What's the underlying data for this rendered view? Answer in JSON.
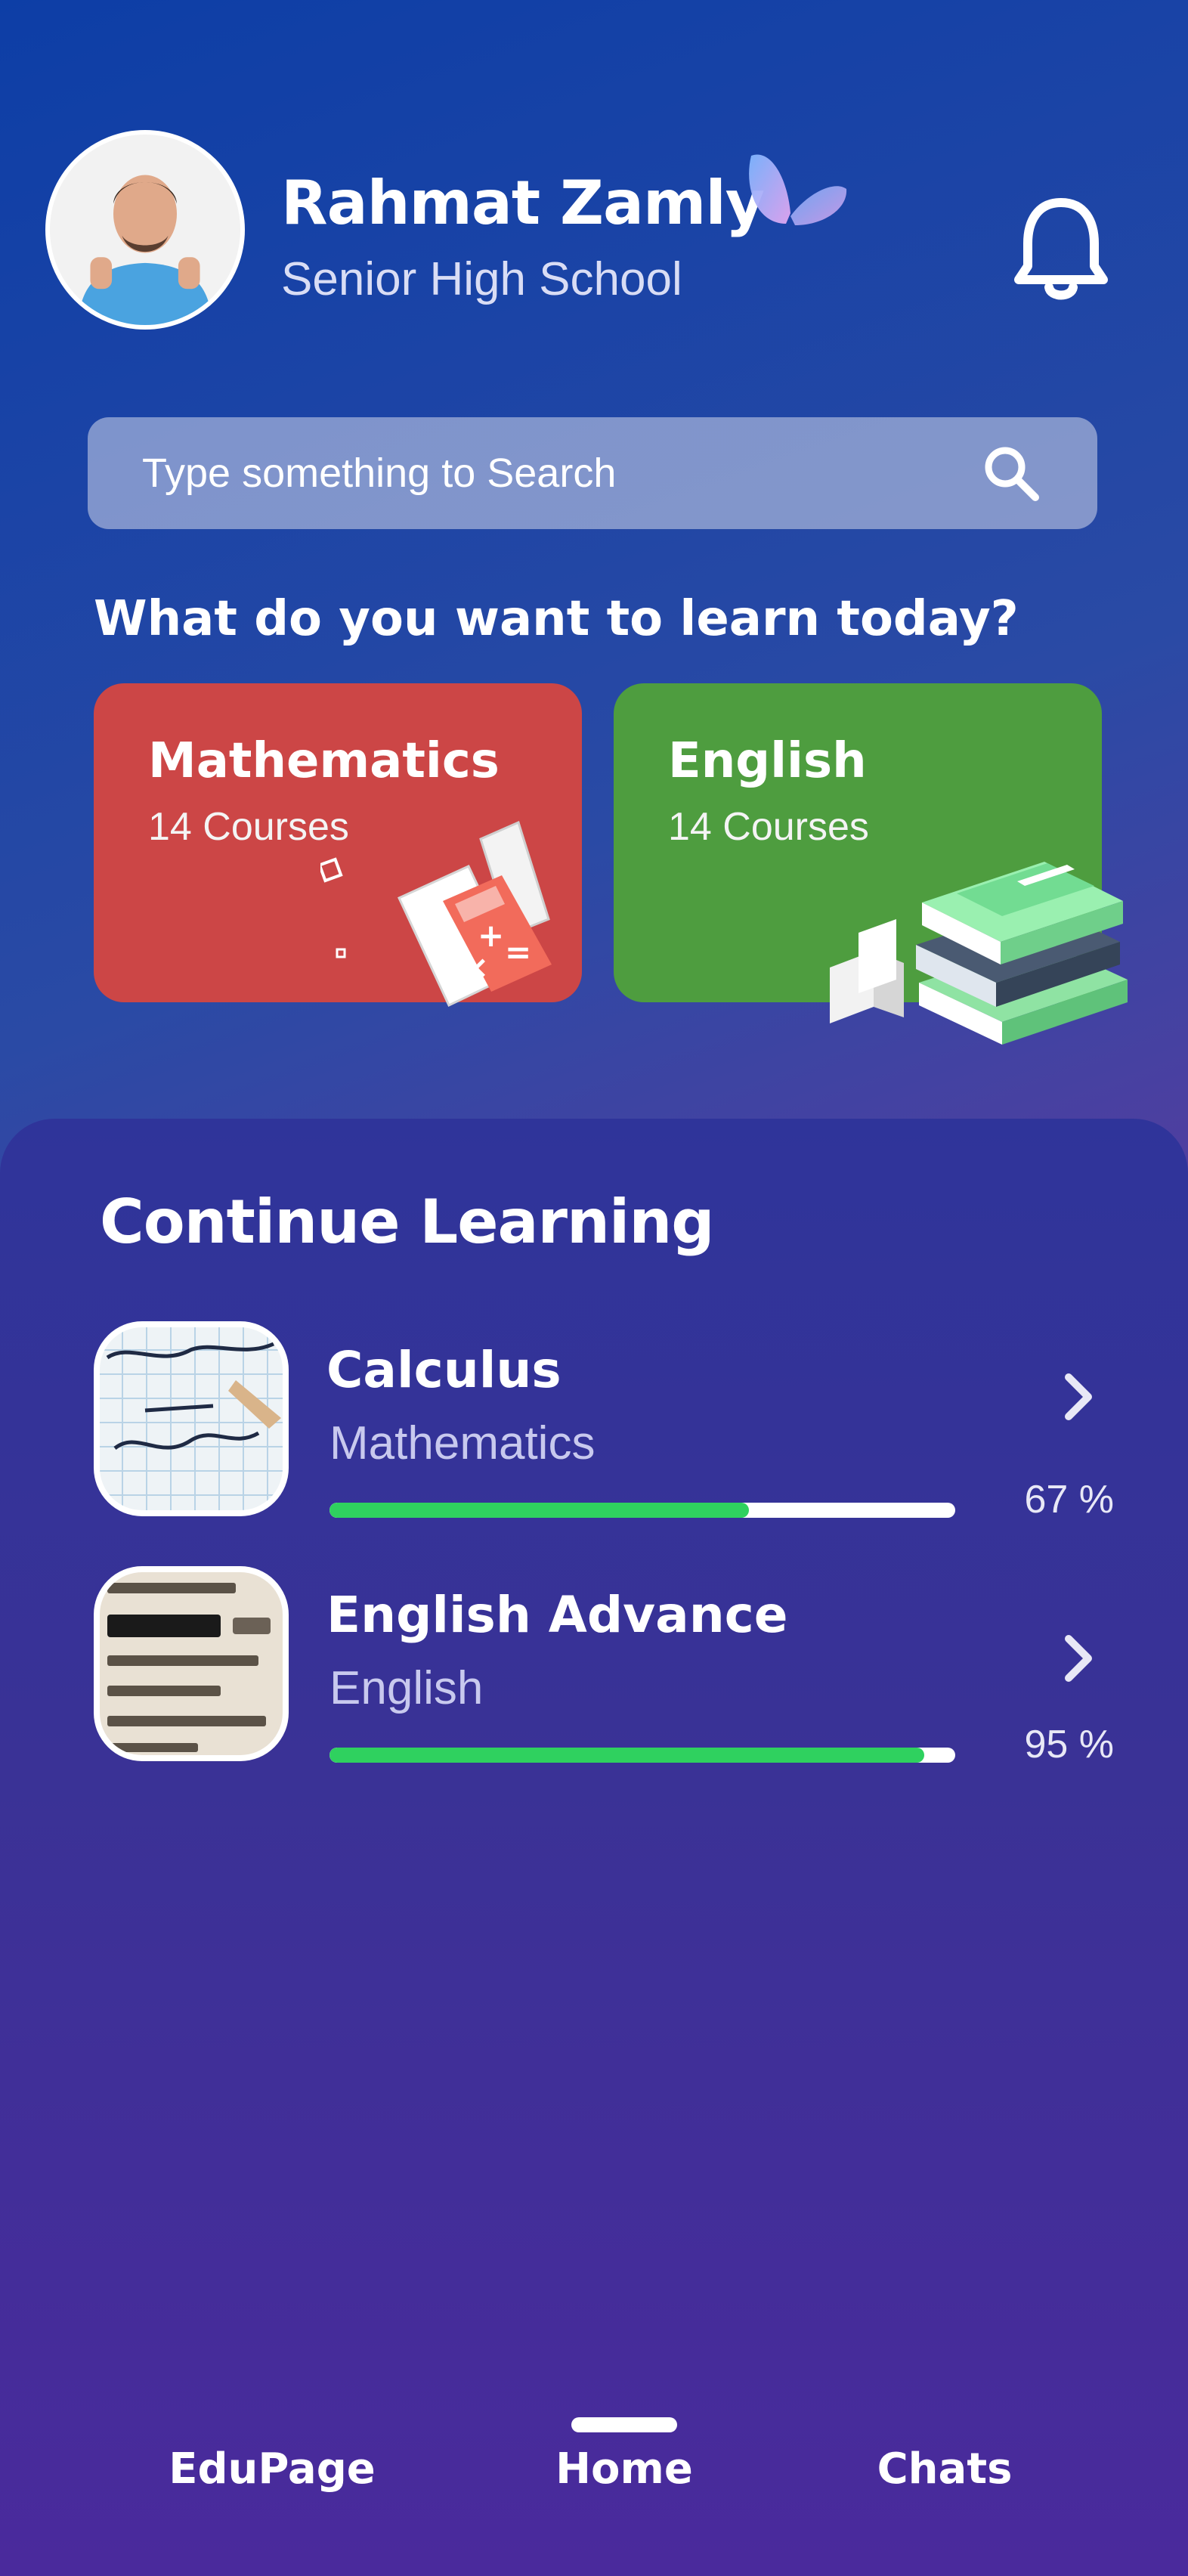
{
  "profile": {
    "name": "Rahmat Zamly",
    "school": "Senior High School"
  },
  "search": {
    "placeholder": "Type something to Search"
  },
  "prompt": "What do you want to learn today?",
  "subjects": [
    {
      "title": "Mathematics",
      "courses": "14 Courses",
      "color": "#cc4646"
    },
    {
      "title": "English",
      "courses": "14 Courses",
      "color": "#4e9d3f"
    }
  ],
  "continue_learning": {
    "title": "Continue Learning",
    "items": [
      {
        "title": "Calculus",
        "subject": "Mathematics",
        "progress_label": "67 %",
        "progress": 0.67
      },
      {
        "title": "English Advance",
        "subject": "English",
        "progress_label": "95 %",
        "progress": 0.95
      }
    ]
  },
  "nav": {
    "items": [
      "EduPage",
      "Home",
      "Chats"
    ],
    "active": "Home"
  },
  "icons": {
    "header_badge": "butterfly-icon",
    "notifications": "bell-icon",
    "search": "search-icon",
    "row_action": "chevron-right-icon"
  },
  "colors": {
    "progress_fill": "#2fd15f",
    "progress_track": "#ffffff"
  }
}
